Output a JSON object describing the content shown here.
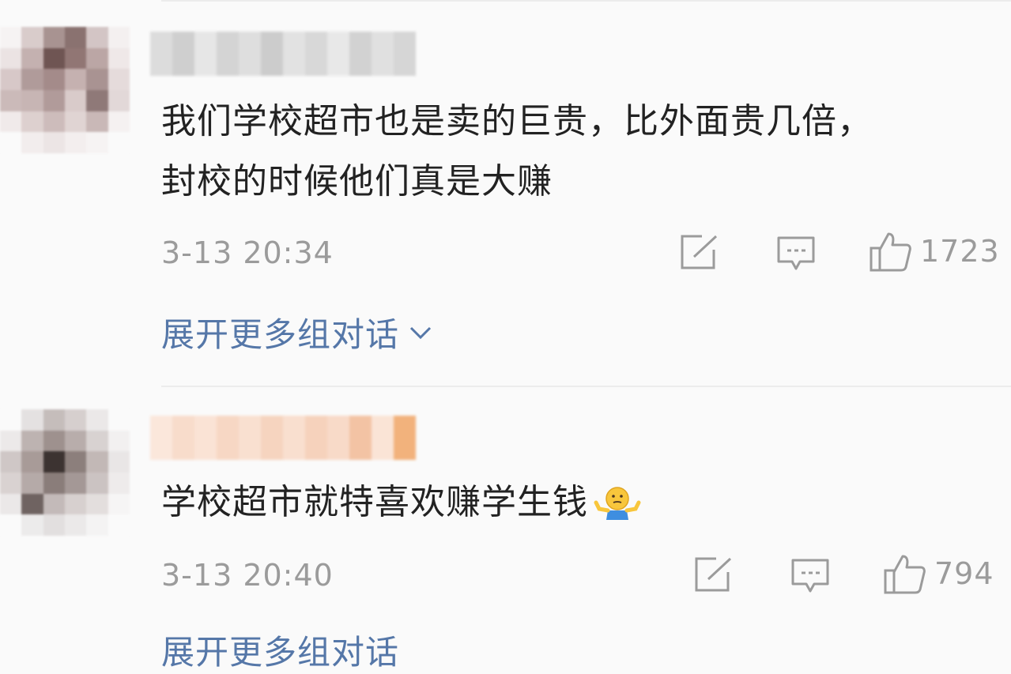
{
  "comments": [
    {
      "text_lines": [
        "我们学校超市也是卖的巨贵，比外面贵几倍，",
        "封校的时候他们真是大赚"
      ],
      "time": "3-13 20:34",
      "likes": "1723",
      "expand_label": "展开更多组对话"
    },
    {
      "text_lines": [
        "学校超市就特喜欢赚学生钱"
      ],
      "time": "3-13 20:40",
      "likes": "794",
      "expand_label": "展开更多组对话"
    }
  ],
  "icons": {
    "share": "share-icon",
    "reply": "comment-icon",
    "like": "thumbs-up-icon",
    "expand": "chevron-down-icon",
    "shrug_emoji": "shrug-emoji-icon"
  },
  "colors": {
    "link": "#5577a8",
    "meta": "#9b9b9b",
    "text": "#222222",
    "background": "#fafafa"
  }
}
